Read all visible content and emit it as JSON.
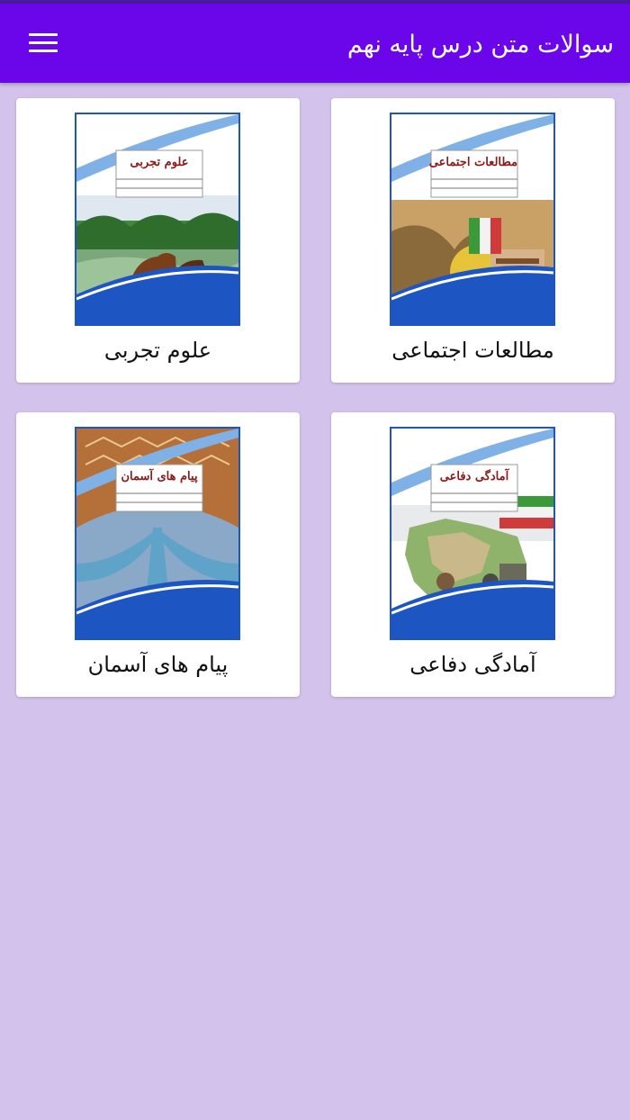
{
  "app": {
    "title": "سوالات متن درس پایه نهم",
    "menu_icon": "hamburger-menu-icon"
  },
  "colors": {
    "appbar": "#6b05ea",
    "background": "#d3c3ec",
    "card": "#ffffff",
    "cover_border": "#1d56c2"
  },
  "books": [
    {
      "label": "مطالعات اجتماعی",
      "cover_title": "مطالعات اجتماعی"
    },
    {
      "label": "علوم تجربی",
      "cover_title": "علوم تجربی"
    },
    {
      "label": "آمادگی دفاعی",
      "cover_title": "آمادگی دفاعی"
    },
    {
      "label": "پیام های آسمان",
      "cover_title": "پیام های آسمان"
    }
  ]
}
